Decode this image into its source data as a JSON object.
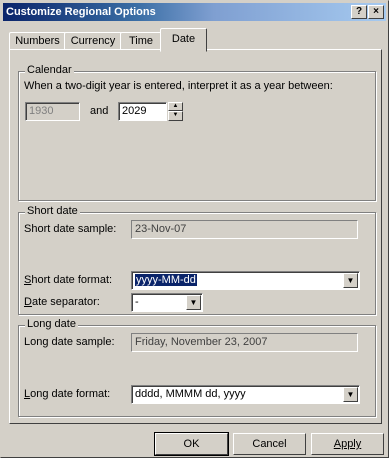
{
  "window": {
    "title": "Customize Regional Options",
    "help_label": "?",
    "close_label": "×"
  },
  "tabs": [
    {
      "label": "Numbers"
    },
    {
      "label": "Currency"
    },
    {
      "label": "Time"
    },
    {
      "label": "Date",
      "active": true
    }
  ],
  "calendar": {
    "title": "Calendar",
    "description": "When a two-digit year is entered, interpret it as a year between:",
    "start_year": "1930",
    "and_label": "and",
    "end_year": "2029"
  },
  "short_date": {
    "title": "Short date",
    "sample_label": "Short date sample:",
    "sample_value": "23-Nov-07",
    "format_label": "Short date format:",
    "format_value": "yyyy-MM-dd",
    "separator_label": "Date separator:",
    "separator_value": "-"
  },
  "long_date": {
    "title": "Long date",
    "sample_label": "Long date sample:",
    "sample_value": "Friday, November 23, 2007",
    "format_label": "Long date format:",
    "format_value": "dddd, MMMM dd, yyyy"
  },
  "buttons": {
    "ok": "OK",
    "cancel": "Cancel",
    "apply": "Apply"
  }
}
